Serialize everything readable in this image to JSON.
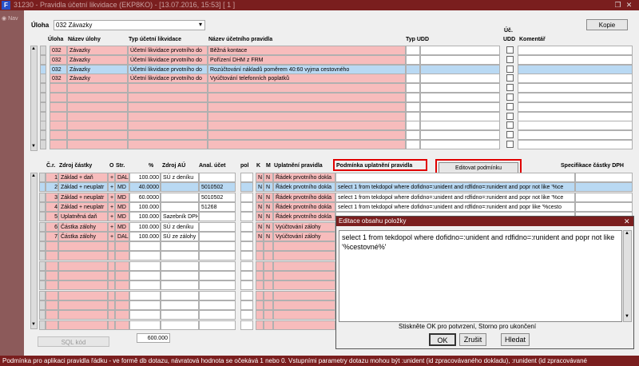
{
  "window": {
    "title": "31230 - Pravidla účetní likvidace (EKP8KO) - [13.07.2016, 15:53] [ 1 ]",
    "icon": "F",
    "nav_label": "Nav"
  },
  "header": {
    "uloha_label": "Úloha",
    "uloha_value": "032 Závazky",
    "kopie_button": "Kopie"
  },
  "top_grid": {
    "columns": {
      "uloha": "Úloha",
      "nazev_ulohy": "Název úlohy",
      "typ_likvidace": "Typ účetní likvidace",
      "nazev_pravidla": "Název účetního pravidla",
      "typ_udd": "Typ UDD",
      "uc_udd_1": "Úč.",
      "uc_udd_2": "UDD",
      "komentar": "Komentář"
    },
    "rows": [
      {
        "uloha": "032",
        "nazev": "Závazky",
        "typ": "Účetní likvidace prvotního do",
        "pravidlo": "Běžná kontace"
      },
      {
        "uloha": "032",
        "nazev": "Závazky",
        "typ": "Účetní likvidace prvotního do",
        "pravidlo": "Pořízení DHM z FRM"
      },
      {
        "uloha": "032",
        "nazev": "Závazky",
        "typ": "Účetní likvidace prvotního do",
        "pravidlo": "Rozúčtování nákladů poměrem 40:60 vyjma cestovného"
      },
      {
        "uloha": "032",
        "nazev": "Závazky",
        "typ": "Účetní likvidace prvotního do",
        "pravidlo": "Vyúčtování telefonních poplatků"
      }
    ]
  },
  "bottom_grid": {
    "columns": {
      "cr": "Č.r.",
      "zdroj": "Zdroj částky",
      "o": "O",
      "str": "Str.",
      "pct": "%",
      "zdroj_au": "Zdroj AÚ",
      "anal": "Anal. účet",
      "pol": "pol",
      "k": "K",
      "m": "M",
      "uplatneni": "Uplatnění pravidla",
      "podminka": "Podmínka uplatnění pravidla",
      "spec": "Specifikace částky DPH"
    },
    "edit_button": "Editovat podmínku",
    "rows": [
      {
        "cr": "1",
        "zdroj": "Základ + daň",
        "o": "+",
        "str": "DAL",
        "pct": "100.000",
        "zdroj_au": "SÚ z deníku",
        "anal": "",
        "k": "N",
        "m": "N",
        "uplatneni": "Řádek prvotního dokla",
        "podminka": ""
      },
      {
        "cr": "2",
        "zdroj": "Základ + neuplatr",
        "o": "+",
        "str": "MD",
        "pct": "40.0000",
        "zdroj_au": "",
        "anal": "5010502",
        "k": "N",
        "m": "N",
        "uplatneni": "Řádek prvotního dokla",
        "podminka": "select 1 from tekdopol where dofidno=:unident and rdfidno=:runident and popr not like '%ce"
      },
      {
        "cr": "3",
        "zdroj": "Základ + neuplatr",
        "o": "+",
        "str": "MD",
        "pct": "60.0000",
        "zdroj_au": "",
        "anal": "5010502",
        "k": "N",
        "m": "N",
        "uplatneni": "Řádek prvotního dokla",
        "podminka": "select 1 from tekdopol where dofidno=:unident and rdfidno=:runident and popr not like '%ce"
      },
      {
        "cr": "4",
        "zdroj": "Základ + neuplatr",
        "o": "+",
        "str": "MD",
        "pct": "100.000",
        "zdroj_au": "",
        "anal": "51268",
        "k": "N",
        "m": "N",
        "uplatneni": "Řádek prvotního dokla",
        "podminka": "select 1 from tekdopol where dofidno=:unident and rdfidno=:runident and popr like '%cesto"
      },
      {
        "cr": "5",
        "zdroj": "Uplatněná daň",
        "o": "+",
        "str": "MD",
        "pct": "100.000",
        "zdroj_au": "Sazebník DPH",
        "anal": "",
        "k": "N",
        "m": "N",
        "uplatneni": "Řádek prvotního dokla",
        "podminka": ""
      },
      {
        "cr": "6",
        "zdroj": "Částka zálohy",
        "o": "+",
        "str": "MD",
        "pct": "100.000",
        "zdroj_au": "SÚ z deníku",
        "anal": "",
        "k": "N",
        "m": "N",
        "uplatneni": "Vyúčtování zálohy",
        "podminka": ""
      },
      {
        "cr": "7",
        "zdroj": "Částka zálohy",
        "o": "+",
        "str": "DAL",
        "pct": "100.000",
        "zdroj_au": "SÚ ze zálohy",
        "anal": "",
        "k": "N",
        "m": "N",
        "uplatneni": "Vyúčtování zálohy",
        "podminka": ""
      }
    ],
    "sql_button": "SQL kód",
    "total_pct": "600.000"
  },
  "dialog": {
    "title": "Editace obsahu položky",
    "text": "select 1 from tekdopol where dofidno=:unident and rdfidno=:runident and popr not like '%cestovné%'",
    "hint": "Stiskněte OK pro potvrzení, Storno pro ukončení",
    "ok": "OK",
    "zrusit": "Zrušit",
    "hledat": "Hledat"
  },
  "statusbar": {
    "text": "Podmínka pro aplikaci pravidla řádku - ve formě db dotazu, návratová hodnota se očekává 1 nebo 0. Vstupními parametry dotazu mohou být :unident (id zpracovávaného dokladu), :runident (id zpracovávané"
  },
  "colors": {
    "titlebar": "#7a1e1e",
    "required_cell": "#f7bcbc",
    "selected_row": "#b9d9f3",
    "highlight_border": "#e00000"
  }
}
